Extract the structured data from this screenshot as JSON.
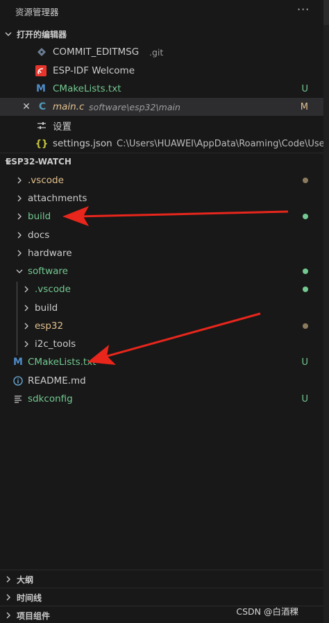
{
  "explorer": {
    "title": "资源管理器",
    "more": "···"
  },
  "open_editors": {
    "header": "打开的编辑器",
    "items": [
      {
        "icon": "git-diamond-icon",
        "name": "COMMIT_EDITMSG",
        "desc": ".git",
        "status": ""
      },
      {
        "icon": "espressif-icon",
        "name": "ESP-IDF Welcome",
        "desc": "",
        "status": ""
      },
      {
        "icon": "cmake-m-icon",
        "name": "CMakeLists.txt",
        "desc": "",
        "status": "U"
      },
      {
        "icon": "c-file-icon",
        "name": "main.c",
        "desc": "software\\esp32\\main",
        "status": "M",
        "close": "✕"
      },
      {
        "icon": "settings-sliders-icon",
        "name": "设置",
        "desc": "",
        "status": ""
      },
      {
        "icon": "json-braces-icon",
        "name": "settings.json",
        "desc": "C:\\Users\\HUAWEI\\AppData\\Roaming\\Code\\User",
        "status": ""
      }
    ]
  },
  "workspace": {
    "header": "ESP32-WATCH",
    "items": [
      {
        "name": ".vscode",
        "type": "folder"
      },
      {
        "name": "attachments",
        "type": "folder"
      },
      {
        "name": "build",
        "type": "folder"
      },
      {
        "name": "docs",
        "type": "folder"
      },
      {
        "name": "hardware",
        "type": "folder"
      },
      {
        "name": "software",
        "type": "folder-open"
      },
      {
        "name": ".vscode",
        "type": "folder"
      },
      {
        "name": "build",
        "type": "folder"
      },
      {
        "name": "esp32",
        "type": "folder"
      },
      {
        "name": "i2c_tools",
        "type": "folder"
      },
      {
        "name": "CMakeLists.txt",
        "type": "file",
        "status": "U"
      },
      {
        "name": "README.md",
        "type": "file"
      },
      {
        "name": "sdkconfig",
        "type": "file",
        "status": "U"
      }
    ]
  },
  "bottom_sections": [
    {
      "label": "大纲"
    },
    {
      "label": "时间线"
    },
    {
      "label": "项目组件"
    }
  ],
  "watermark": "CSDN @白酒稞",
  "colors": {
    "untracked": "#73c991",
    "modified": "#e2c08d",
    "arrow": "#e8261c",
    "background": "#181818"
  }
}
